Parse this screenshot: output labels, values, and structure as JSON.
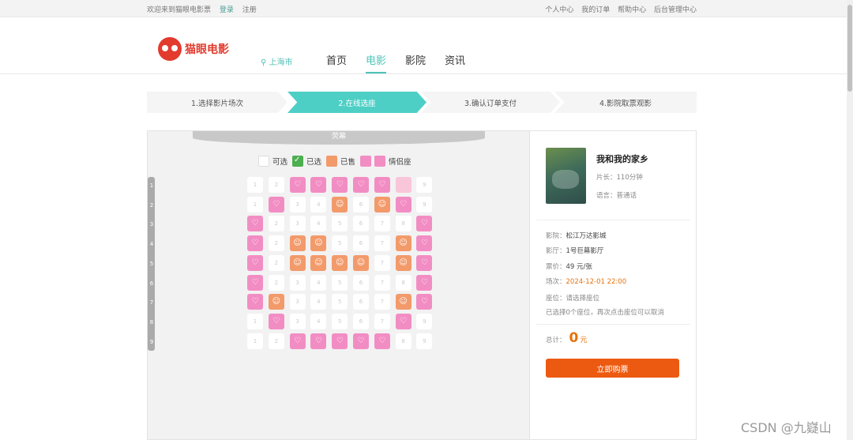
{
  "topbar": {
    "welcome": "欢迎来到猫眼电影票",
    "login": "登录",
    "register": "注册",
    "links": [
      "个人中心",
      "我的订单",
      "帮助中心",
      "后台管理中心"
    ]
  },
  "header": {
    "logo_text": "猫眼电影",
    "city": "上海市",
    "nav": [
      "首页",
      "电影",
      "影院",
      "资讯"
    ],
    "active_nav": "电影"
  },
  "steps": [
    "1.选择影片场次",
    "2.在线选座",
    "3.确认订单支付",
    "4.影院取票观影"
  ],
  "current_step": 2,
  "seat_map": {
    "screen_label": "荧幕",
    "legend": {
      "available": "可选",
      "selected": "已选",
      "sold": "已售",
      "couple": "情侣座"
    },
    "rows": [
      "1",
      "2",
      "3",
      "4",
      "5",
      "6",
      "7",
      "8",
      "9"
    ],
    "seat_grid": [
      [
        "a",
        "a",
        "c",
        "c",
        "c",
        "c",
        "c",
        "f",
        "a"
      ],
      [
        "a",
        "c",
        "a",
        "a",
        "s",
        "a",
        "s",
        "c",
        "a"
      ],
      [
        "c",
        "a",
        "a",
        "a",
        "a",
        "a",
        "a",
        "a",
        "c"
      ],
      [
        "c",
        "a",
        "s",
        "s",
        "a",
        "a",
        "a",
        "s",
        "c"
      ],
      [
        "c",
        "a",
        "s",
        "s",
        "s",
        "s",
        "a",
        "s",
        "c"
      ],
      [
        "c",
        "a",
        "a",
        "a",
        "a",
        "a",
        "a",
        "a",
        "c"
      ],
      [
        "c",
        "s",
        "a",
        "a",
        "a",
        "a",
        "a",
        "s",
        "c"
      ],
      [
        "a",
        "c",
        "a",
        "a",
        "a",
        "a",
        "a",
        "c",
        "a"
      ],
      [
        "a",
        "a",
        "c",
        "c",
        "c",
        "c",
        "c",
        "a",
        "a"
      ]
    ]
  },
  "movie": {
    "title": "我和我的家乡",
    "duration": "片长：110分钟",
    "language": "语言：普通话",
    "cinema_label": "影院：",
    "cinema": "松江万达影城",
    "hall_label": "影厅：",
    "hall": "1号巨幕影厅",
    "price_label": "票价：",
    "price": "49 元/张",
    "showtime_label": "场次：",
    "showtime": "2024-12-01 22:00",
    "seat_label": "座位：",
    "seat": "请选择座位",
    "hint": "已选择0个座位，再次点击座位可以取消",
    "total_label": "总计：",
    "total": "0",
    "total_unit": "元",
    "buy_button": "立即购票"
  },
  "watermark": "CSDN @九嶷山",
  "colors": {
    "accent": "#4ecfc6",
    "brand_red": "#e23b2e",
    "buy_orange": "#ec5a11",
    "couple_pink": "#f28dc4",
    "sold_orange": "#f39a6b",
    "selected_green": "#4caf50"
  }
}
